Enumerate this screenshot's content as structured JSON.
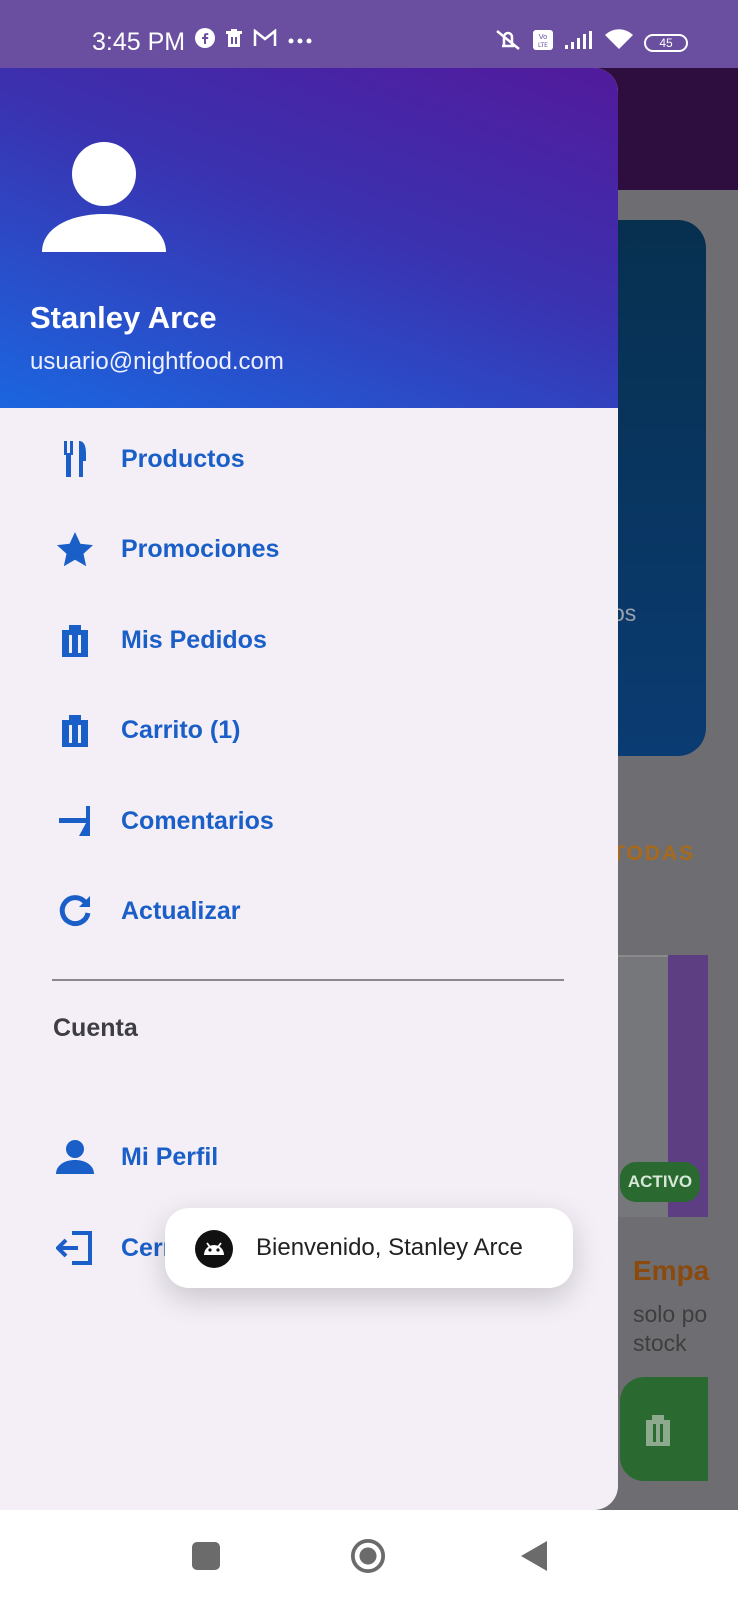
{
  "status_bar": {
    "time": "3:45 PM",
    "battery": "45",
    "icons_left": [
      "facebook-icon",
      "trash-icon",
      "gmail-icon",
      "more-dots-icon"
    ],
    "icons_right": [
      "vibrate-off-icon",
      "volte-icon",
      "signal-icon",
      "wifi-icon",
      "battery-icon"
    ]
  },
  "background": {
    "card_text": "os",
    "filter_label": "TODAS",
    "badge": "ACTIVO",
    "product_name": "Empa",
    "product_desc": "solo po stock"
  },
  "drawer": {
    "user": {
      "name": "Stanley Arce",
      "email": "usuario@nightfood.com"
    },
    "items": [
      {
        "label": "Productos",
        "icon": "utensils-icon"
      },
      {
        "label": "Promociones",
        "icon": "star-icon"
      },
      {
        "label": "Mis Pedidos",
        "icon": "bag-icon"
      },
      {
        "label": "Carrito (1)",
        "icon": "cart-icon"
      },
      {
        "label": "Comentarios",
        "icon": "comment-icon"
      },
      {
        "label": "Actualizar",
        "icon": "refresh-icon"
      }
    ],
    "account_section": "Cuenta",
    "account_items": [
      {
        "label": "Mi Perfil",
        "icon": "person-icon"
      },
      {
        "label": "Cerrar Sesión",
        "icon": "logout-icon"
      }
    ]
  },
  "toast": {
    "text": "Bienvenido, Stanley Arce",
    "icon": "android-icon"
  },
  "nav_bar": {
    "buttons": [
      "recents-button",
      "home-button",
      "back-button"
    ]
  },
  "colors": {
    "accent": "#1a5fc8",
    "drawer_bg": "#f4eff7",
    "header_start": "#521a9c",
    "header_end": "#1b66e0"
  }
}
